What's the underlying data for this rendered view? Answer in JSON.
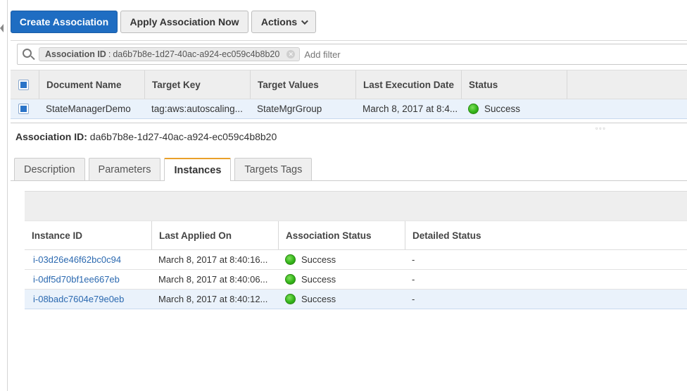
{
  "toolbar": {
    "create_label": "Create Association",
    "apply_label": "Apply Association Now",
    "actions_label": "Actions"
  },
  "filter": {
    "token_key": "Association ID",
    "token_sep": ":",
    "token_value": "da6b7b8e-1d27-40ac-a924-ec059c4b8b20",
    "placeholder": "Add filter"
  },
  "associations": {
    "columns": [
      "Document Name",
      "Target Key",
      "Target Values",
      "Last Execution Date",
      "Status"
    ],
    "rows": [
      {
        "document_name": "StateManagerDemo",
        "target_key": "tag:aws:autoscaling...",
        "target_values": "StateMgrGroup",
        "last_execution_date": "March 8, 2017 at 8:4...",
        "status": "Success"
      }
    ]
  },
  "detail": {
    "label": "Association ID:",
    "value": "da6b7b8e-1d27-40ac-a924-ec059c4b8b20"
  },
  "tabs": [
    {
      "label": "Description",
      "active": false
    },
    {
      "label": "Parameters",
      "active": false
    },
    {
      "label": "Instances",
      "active": true
    },
    {
      "label": "Targets Tags",
      "active": false
    }
  ],
  "instances": {
    "columns": [
      "Instance ID",
      "Last Applied On",
      "Association Status",
      "Detailed Status"
    ],
    "rows": [
      {
        "instance_id": "i-03d26e46f62bc0c94",
        "last_applied": "March 8, 2017 at 8:40:16...",
        "status": "Success",
        "detailed": "-"
      },
      {
        "instance_id": "i-0df5d70bf1ee667eb",
        "last_applied": "March 8, 2017 at 8:40:06...",
        "status": "Success",
        "detailed": "-"
      },
      {
        "instance_id": "i-08badc7604e79e0eb",
        "last_applied": "March 8, 2017 at 8:40:12...",
        "status": "Success",
        "detailed": "-"
      }
    ]
  },
  "colors": {
    "primary": "#1f6dc2",
    "link": "#2b69b0",
    "success": "#35b51b",
    "selected_row": "#eaf2fb",
    "active_tab_accent": "#e9a02a"
  },
  "icons": {
    "search": "search-icon",
    "clear_token": "clear-token-icon",
    "status_success": "status-success-icon",
    "dropdown": "chevron-down-icon"
  }
}
